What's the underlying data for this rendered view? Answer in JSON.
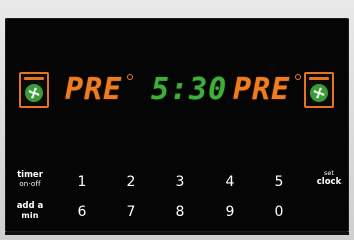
{
  "display": {
    "left_mode": "PRE",
    "time": "5:30",
    "right_mode": "PRE"
  },
  "icons": {
    "left_oven": "oven-fan-icon",
    "right_oven": "oven-fan-icon"
  },
  "colors": {
    "orange": "#f07c20",
    "green": "#3fae3a",
    "panel": "#050505"
  },
  "keypad": {
    "row1": {
      "label_main": "timer",
      "label_sub": "on·off",
      "digits": [
        "1",
        "2",
        "3",
        "4",
        "5"
      ],
      "right_label_top": "set",
      "right_label_main": "clock"
    },
    "row2": {
      "label_main": "add a",
      "label_sub": "min",
      "digits": [
        "6",
        "7",
        "8",
        "9",
        "0"
      ]
    }
  }
}
